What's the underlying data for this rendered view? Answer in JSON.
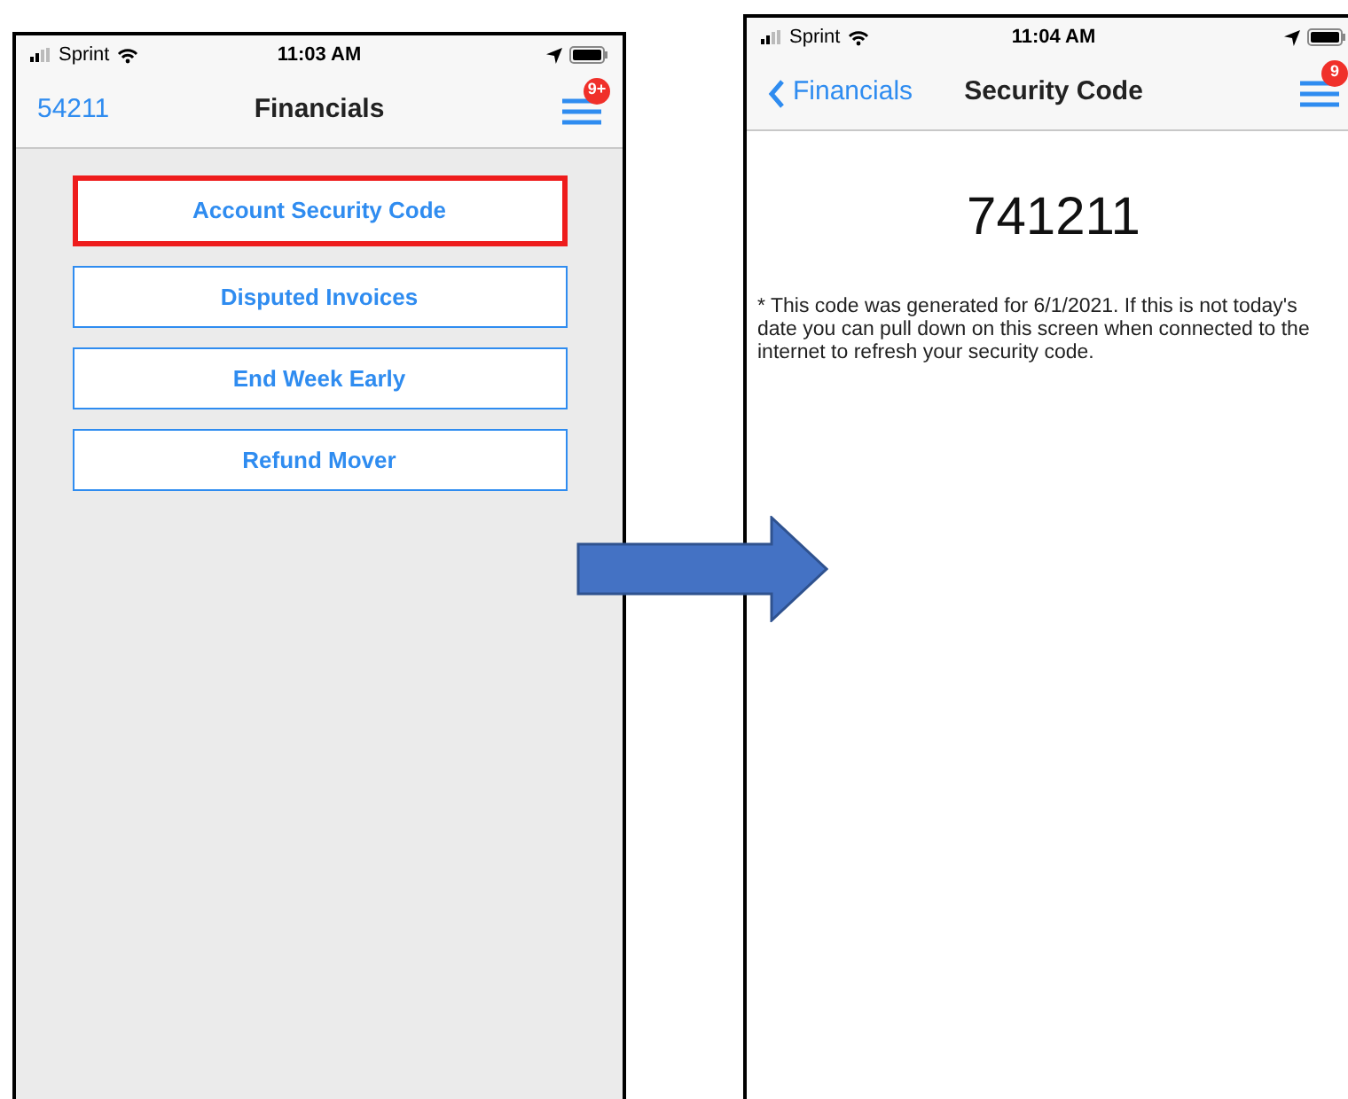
{
  "left_screen": {
    "status_bar": {
      "carrier": "Sprint",
      "time": "11:03 AM"
    },
    "nav_bar": {
      "back": "54211",
      "title": "Financials",
      "badge": "9+"
    },
    "buttons": [
      {
        "label": "Account Security Code",
        "selected": true
      },
      {
        "label": "Disputed Invoices",
        "selected": false
      },
      {
        "label": "End Week Early",
        "selected": false
      },
      {
        "label": "Refund Mover",
        "selected": false
      }
    ]
  },
  "right_screen": {
    "status_bar": {
      "carrier": "Sprint",
      "time": "11:04 AM"
    },
    "nav_bar": {
      "back": "Financials",
      "title": "Security Code",
      "badge": "9"
    },
    "code": "741211",
    "note": "* This code was generated for 6/1/2021. If this is not today's date you can pull down on this screen when connected to the internet to refresh your security code."
  }
}
